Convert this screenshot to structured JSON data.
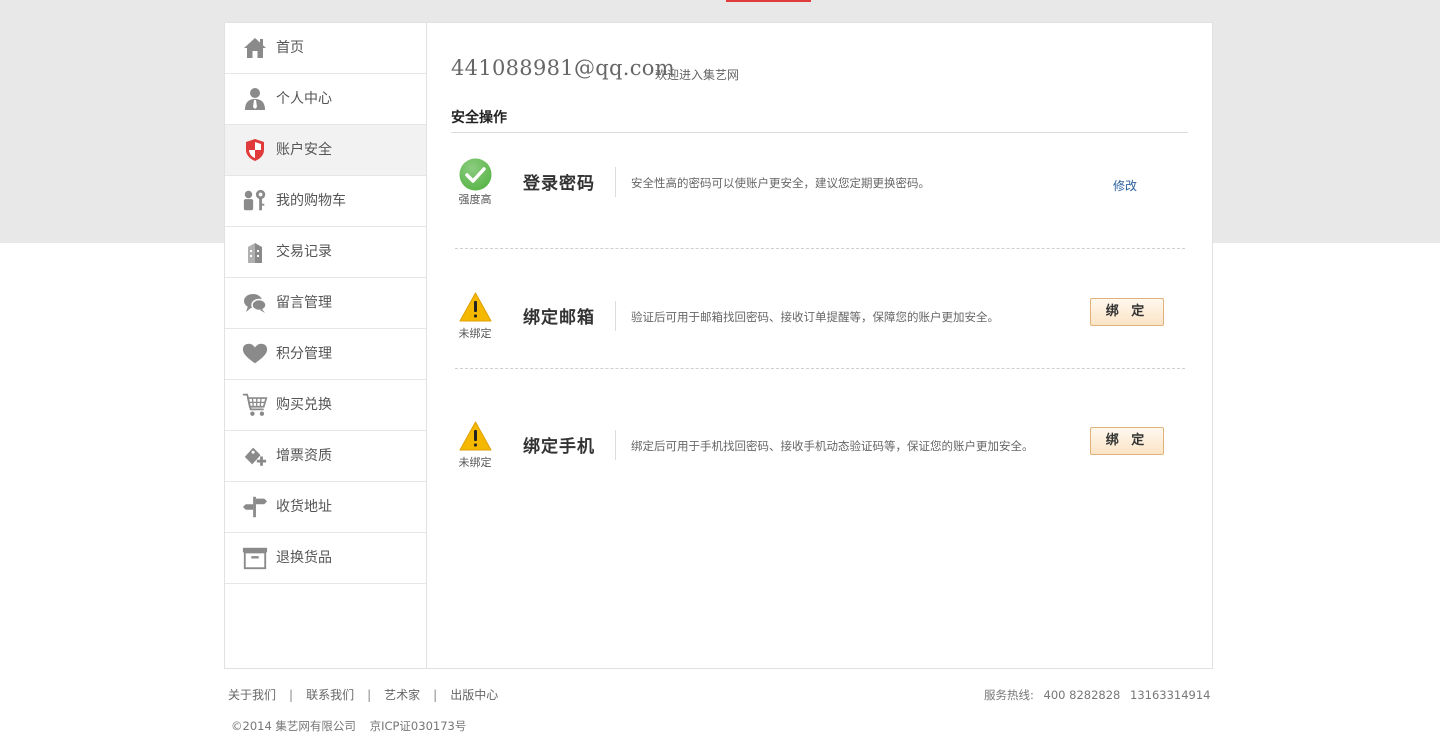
{
  "sidebar": {
    "items": [
      {
        "label": "首页",
        "icon": "home-icon"
      },
      {
        "label": "个人中心",
        "icon": "user-icon"
      },
      {
        "label": "账户安全",
        "icon": "shield-icon"
      },
      {
        "label": "我的购物车",
        "icon": "people-key-icon"
      },
      {
        "label": "交易记录",
        "icon": "building-icon"
      },
      {
        "label": "留言管理",
        "icon": "chat-icon"
      },
      {
        "label": "积分管理",
        "icon": "heart-icon"
      },
      {
        "label": "购买兑换",
        "icon": "cart-icon"
      },
      {
        "label": "增票资质",
        "icon": "ticket-plus-icon"
      },
      {
        "label": "收货地址",
        "icon": "signpost-icon"
      },
      {
        "label": "退换货品",
        "icon": "box-icon"
      }
    ],
    "active_index": 2
  },
  "header": {
    "email": "441088981@qq.com",
    "welcome": "欢迎进入集艺网"
  },
  "section": {
    "title": "安全操作"
  },
  "security_items": [
    {
      "status_icon": "check-icon",
      "status_text": "强度高",
      "title": "登录密码",
      "description": "安全性高的密码可以使账户更安全，建议您定期更换密码。",
      "action": "修改"
    },
    {
      "status_icon": "warning-icon",
      "status_text": "未绑定",
      "title": "绑定邮箱",
      "description": "验证后可用于邮箱找回密码、接收订单提醒等，保障您的账户更加安全。",
      "action": "绑 定"
    },
    {
      "status_icon": "warning-icon",
      "status_text": "未绑定",
      "title": "绑定手机",
      "description": "绑定后可用于手机找回密码、接收手机动态验证码等，保证您的账户更加安全。",
      "action": "绑 定"
    }
  ],
  "footer": {
    "links": [
      "关于我们",
      "联系我们",
      "艺术家",
      "出版中心"
    ],
    "separator": "|",
    "hotline_label": "服务热线:",
    "hotline_1": "400 8282828",
    "hotline_2": "13163314914",
    "copyright": "©2014 集艺网有限公司",
    "icp": "京ICP证030173号"
  },
  "colors": {
    "accent_red": "#e23b3b",
    "link_blue": "#2b5f9e",
    "check_green": "#5bb64a",
    "warning_yellow": "#f5b800",
    "shield_red": "#e03a3a",
    "icon_gray": "#8a8a8a"
  }
}
